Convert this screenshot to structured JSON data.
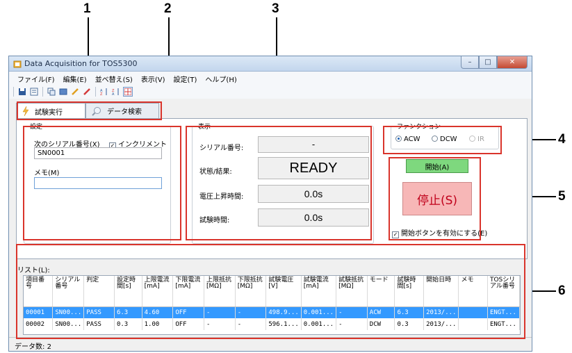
{
  "callouts": [
    "1",
    "2",
    "3",
    "4",
    "5",
    "6"
  ],
  "window": {
    "title": "Data Acquisition for TOS5300",
    "btn_min": "–",
    "btn_max": "□",
    "btn_close": "✕"
  },
  "menu": [
    "ファイル(F)",
    "編集(E)",
    "並べ替え(S)",
    "表示(V)",
    "設定(T)",
    "ヘルプ(H)"
  ],
  "toolbar_icons": [
    "save-icon",
    "open-icon",
    "copy-icon",
    "table-icon",
    "pencil-icon",
    "eraser-icon",
    "sort-asc-icon",
    "sort-desc-icon",
    "grid-icon"
  ],
  "tabs": [
    {
      "label": "試験実行",
      "icon": "run-icon",
      "active": true
    },
    {
      "label": "データ検索",
      "icon": "search-icon",
      "active": false
    }
  ],
  "settings": {
    "group_label": "設定",
    "serial_label": "次のシリアル番号(X)",
    "increment_label": "インクリメント(I)",
    "increment_checked": true,
    "serial_value": "SN0001",
    "memo_label": "メモ(M)",
    "memo_value": ""
  },
  "display": {
    "group_label": "表示",
    "serial_label": "シリアル番号:",
    "serial_value": "-",
    "status_label": "状態/結果:",
    "status_value": "READY",
    "rise_label": "電圧上昇時間:",
    "rise_value": "0.0s",
    "test_time_label": "試験時間:",
    "test_time_value": "0.0s"
  },
  "function": {
    "group_label": "ファンクション",
    "options": [
      {
        "label": "ACW",
        "selected": true,
        "enabled": true
      },
      {
        "label": "DCW",
        "selected": false,
        "enabled": true
      },
      {
        "label": "IR",
        "selected": false,
        "enabled": false
      }
    ]
  },
  "control": {
    "start_label": "開始(A)",
    "stop_label": "停止(S)",
    "enable_start_label": "開始ボタンを有効にする(E)",
    "enable_start_checked": true,
    "start_color": "#7ed87e",
    "stop_color": "#f7b7b7"
  },
  "list": {
    "label": "リスト(L):",
    "headers": [
      "項目番号",
      "シリアル番号",
      "判定",
      "設定時間[s]",
      "上限電流[mA]",
      "下限電流[mA]",
      "上限抵抗[MΩ]",
      "下限抵抗[MΩ]",
      "試験電圧[V]",
      "試験電流[mA]",
      "試験抵抗[MΩ]",
      "モード",
      "試験時間[s]",
      "開始日時",
      "メモ",
      "TOSシリアル番号"
    ],
    "rows": [
      [
        "00001",
        "SN00...",
        "PASS",
        "6.3",
        "4.60",
        "OFF",
        "-",
        "-",
        "498.9...",
        "0.001...",
        "-",
        "ACW",
        "6.3",
        "2013/...",
        "",
        "ENGT..."
      ],
      [
        "00002",
        "SN00...",
        "PASS",
        "0.3",
        "1.00",
        "OFF",
        "-",
        "-",
        "596.1...",
        "0.001...",
        "-",
        "DCW",
        "0.3",
        "2013/...",
        "",
        "ENGT..."
      ]
    ],
    "selected_row": 0
  },
  "status": {
    "count_label": "データ数:",
    "count_value": "2"
  },
  "colors": {
    "callout": "#d9342b",
    "selection": "#3399ff"
  }
}
